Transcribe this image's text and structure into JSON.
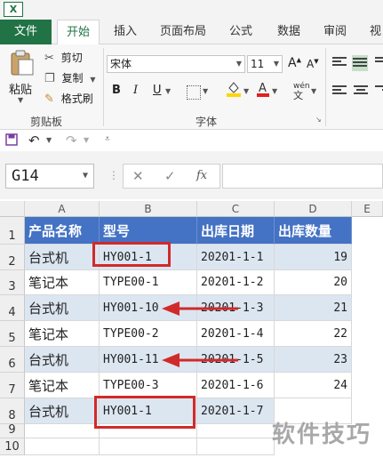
{
  "app": {
    "icon_letter": "X"
  },
  "ribbon_tabs": [
    "文件",
    "开始",
    "插入",
    "页面布局",
    "公式",
    "数据",
    "审阅",
    "视"
  ],
  "clipboard": {
    "paste": "粘贴",
    "cut": "剪切",
    "copy": "复制",
    "format_painter": "格式刷",
    "group": "剪贴板"
  },
  "font": {
    "name": "宋体",
    "size": "11",
    "bold": "B",
    "italic": "I",
    "underline": "U",
    "wen": "wén",
    "group": "字体"
  },
  "quick_access": {
    "save": "save",
    "undo": "undo",
    "redo": "redo"
  },
  "formula_bar": {
    "name_box": "G14",
    "cancel": "✕",
    "enter": "✓",
    "fx": "fx",
    "formula": ""
  },
  "columns": [
    "A",
    "B",
    "C",
    "D",
    "E"
  ],
  "rows": [
    "1",
    "2",
    "3",
    "4",
    "5",
    "6",
    "7",
    "8",
    "9",
    "10"
  ],
  "table": {
    "headers": [
      "产品名称",
      "型号",
      "出库日期",
      "出库数量"
    ],
    "rows": [
      [
        "台式机",
        "HY001-1",
        "20201-1-1",
        "19"
      ],
      [
        "笔记本",
        "TYPE00-1",
        "20201-1-2",
        "20"
      ],
      [
        "台式机",
        "HY001-10",
        "20201-1-3",
        "21"
      ],
      [
        "笔记本",
        "TYPE00-2",
        "20201-1-4",
        "22"
      ],
      [
        "台式机",
        "HY001-11",
        "20201-1-5",
        "23"
      ],
      [
        "笔记本",
        "TYPE00-3",
        "20201-1-6",
        "24"
      ],
      [
        "台式机",
        "HY001-1",
        "20201-1-7",
        ""
      ]
    ]
  },
  "annotations": {
    "box_color": "#d12a2a",
    "arrow_color": "#d12a2a"
  },
  "watermark": "软件技巧"
}
